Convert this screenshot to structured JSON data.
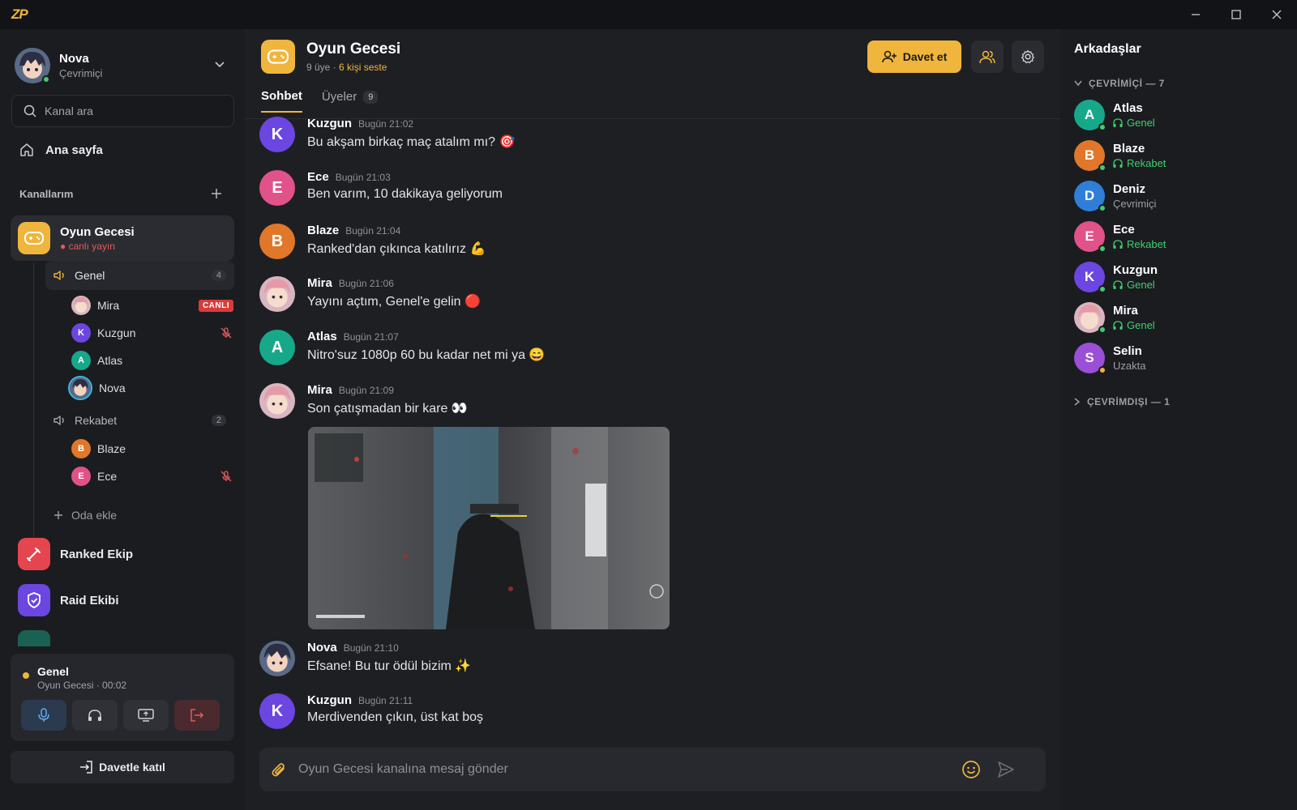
{
  "app": {
    "logo_text": "ZP"
  },
  "user": {
    "name": "Nova",
    "status": "Çevrimiçi"
  },
  "search": {
    "placeholder": "Kanal ara"
  },
  "nav": {
    "home_label": "Ana sayfa"
  },
  "my_channels": {
    "title": "Kanallarım"
  },
  "active_channel": {
    "name": "Oyun Gecesi",
    "sub": "● canlı yayın",
    "rooms": [
      {
        "name": "Genel",
        "count": "4",
        "members": [
          {
            "name": "Mira",
            "initial": "",
            "badge": "CANLI"
          },
          {
            "name": "Kuzgun",
            "initial": "K",
            "muted": true
          },
          {
            "name": "Atlas",
            "initial": "A"
          },
          {
            "name": "Nova",
            "initial": ""
          }
        ]
      },
      {
        "name": "Rekabet",
        "count": "2",
        "members": [
          {
            "name": "Blaze",
            "initial": "B"
          },
          {
            "name": "Ece",
            "initial": "E",
            "muted": true
          }
        ]
      }
    ],
    "add_room": "Oda ekle"
  },
  "other_channels": [
    {
      "name": "Ranked Ekip",
      "icon": "sword-icon"
    },
    {
      "name": "Raid Ekibi",
      "icon": "shield-icon"
    }
  ],
  "voice": {
    "room": "Genel",
    "sub": "Oyun Gecesi · 00:02"
  },
  "join_invite": "Davetle katıl",
  "header": {
    "title": "Oyun Gecesi",
    "members_text": "9 üye · ",
    "in_voice_text": "6 kişi seste",
    "invite_label": "Davet et"
  },
  "tabs": [
    {
      "label": "Sohbet",
      "active": true
    },
    {
      "label": "Üyeler",
      "badge": "9"
    }
  ],
  "messages": [
    {
      "author": "Kuzgun",
      "time": "Bugün 21:02",
      "text": "Bu akşam birkaç maç atalım mı? 🎯",
      "initial": "K"
    },
    {
      "author": "Ece",
      "time": "Bugün 21:03",
      "text": "Ben varım, 10 dakikaya geliyorum",
      "initial": "E"
    },
    {
      "author": "Blaze",
      "time": "Bugün 21:04",
      "text": "Ranked'dan çıkınca katılırız 💪",
      "initial": "B"
    },
    {
      "author": "Mira",
      "time": "Bugün 21:06",
      "text": "Yayını açtım, Genel'e gelin 🔴",
      "initial": ""
    },
    {
      "author": "Atlas",
      "time": "Bugün 21:07",
      "text": "Nitro'suz 1080p 60 bu kadar net mi ya 😄",
      "initial": "A"
    },
    {
      "author": "Mira",
      "time": "Bugün 21:09",
      "text": "Son çatışmadan bir kare 👀",
      "initial": ""
    },
    {
      "author": "Nova",
      "time": "Bugün 21:10",
      "text": "Efsane! Bu tur ödül bizim ✨",
      "initial": ""
    },
    {
      "author": "Kuzgun",
      "time": "Bugün 21:11",
      "text": "Merdivenden çıkın, üst kat boş",
      "initial": "K"
    }
  ],
  "composer": {
    "placeholder": "Oyun Gecesi kanalına mesaj gönder"
  },
  "friends": {
    "title": "Arkadaşlar",
    "online_header": "ÇEVRİMİÇİ — 7",
    "offline_header": "ÇEVRİMDIŞI — 1",
    "list": [
      {
        "name": "Atlas",
        "status": "Genel",
        "initial": "A"
      },
      {
        "name": "Blaze",
        "status": "Rekabet",
        "initial": "B"
      },
      {
        "name": "Deniz",
        "status": "Çevrimiçi",
        "initial": "D"
      },
      {
        "name": "Ece",
        "status": "Rekabet",
        "initial": "E"
      },
      {
        "name": "Kuzgun",
        "status": "Genel",
        "initial": "K"
      },
      {
        "name": "Mira",
        "status": "Genel",
        "initial": ""
      },
      {
        "name": "Selin",
        "status": "Uzakta",
        "initial": "S"
      }
    ]
  },
  "colors": {
    "accent": "#f0b53c",
    "online": "#3ecf6e",
    "live": "#d93b3b"
  }
}
